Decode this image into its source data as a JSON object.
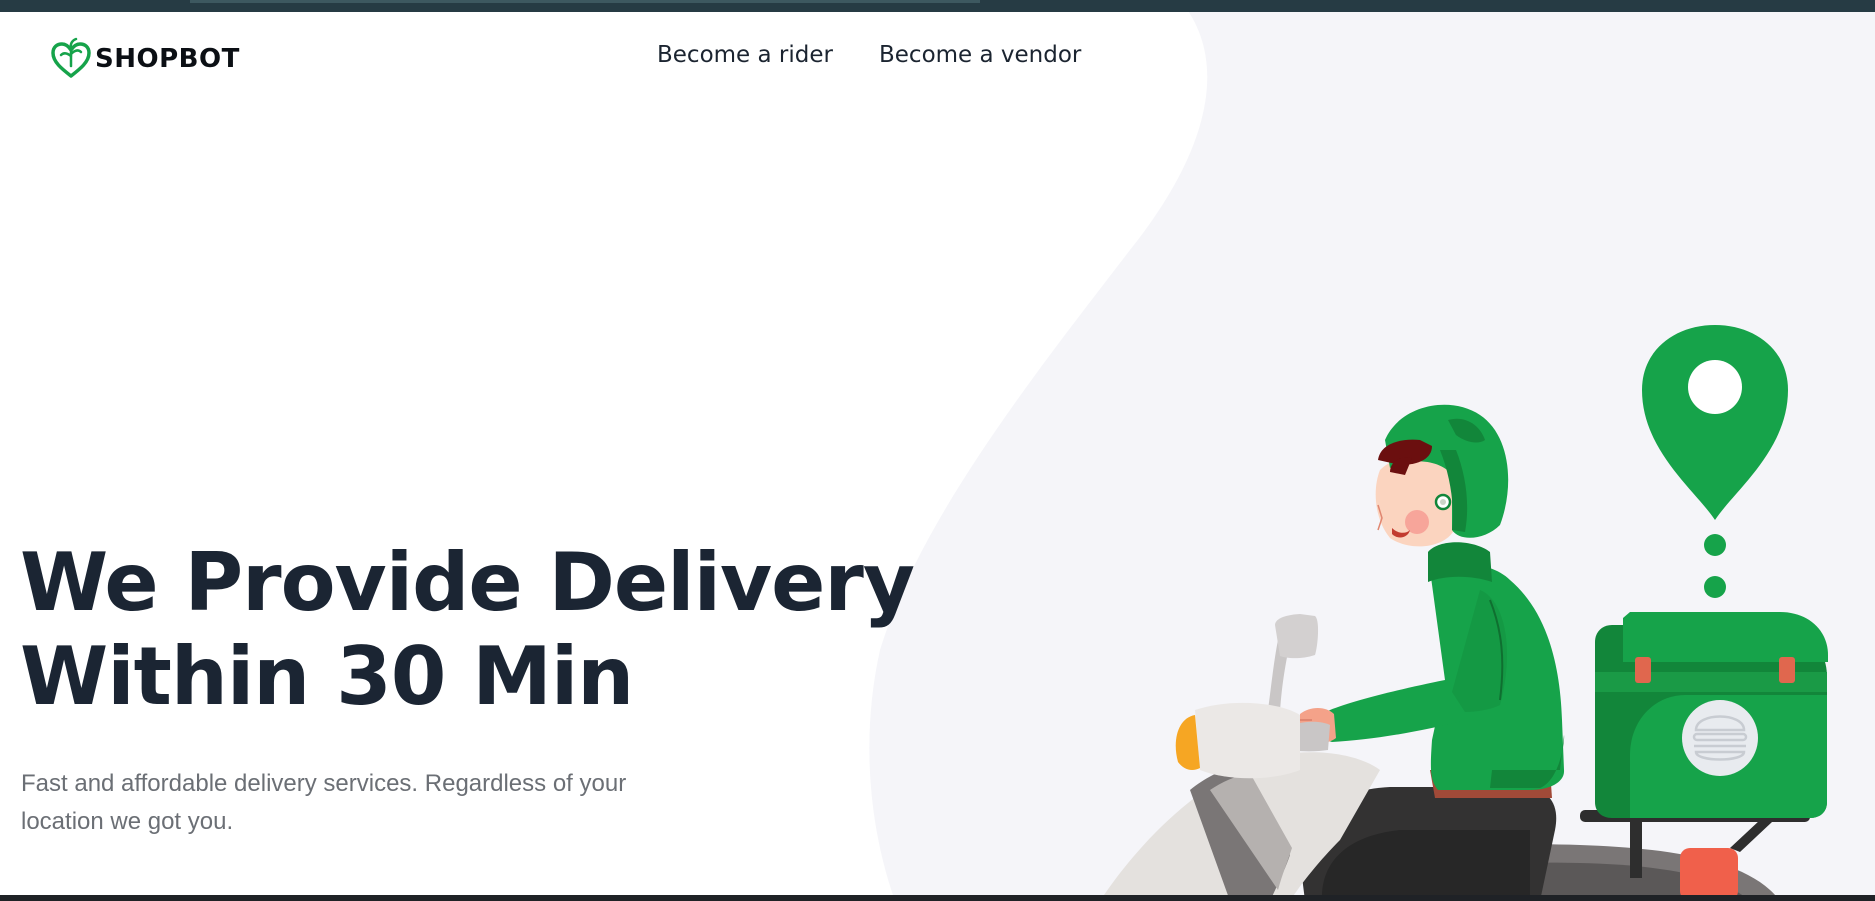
{
  "brand": {
    "name": "SHOPBOT",
    "logo_icon": "heart-leaf-logo-icon",
    "accent_color": "#16a34a"
  },
  "nav": {
    "links": [
      {
        "label": "Become a rider"
      },
      {
        "label": "Become a vendor"
      }
    ]
  },
  "hero": {
    "title_line1": "We Provide Delivery",
    "title_line2": "Within 30 Min",
    "subtitle": "Fast and affordable delivery services. Regardless of your location we got you."
  },
  "illustration": {
    "subject": "delivery-rider-on-scooter",
    "icons": [
      "location-pin-icon",
      "delivery-box-icon",
      "burger-icon"
    ]
  },
  "colors": {
    "panel_bg": "#f5f5f9",
    "title_text": "#1b2533",
    "subtitle_text": "#6b6f75",
    "top_bar": "#263b44"
  }
}
